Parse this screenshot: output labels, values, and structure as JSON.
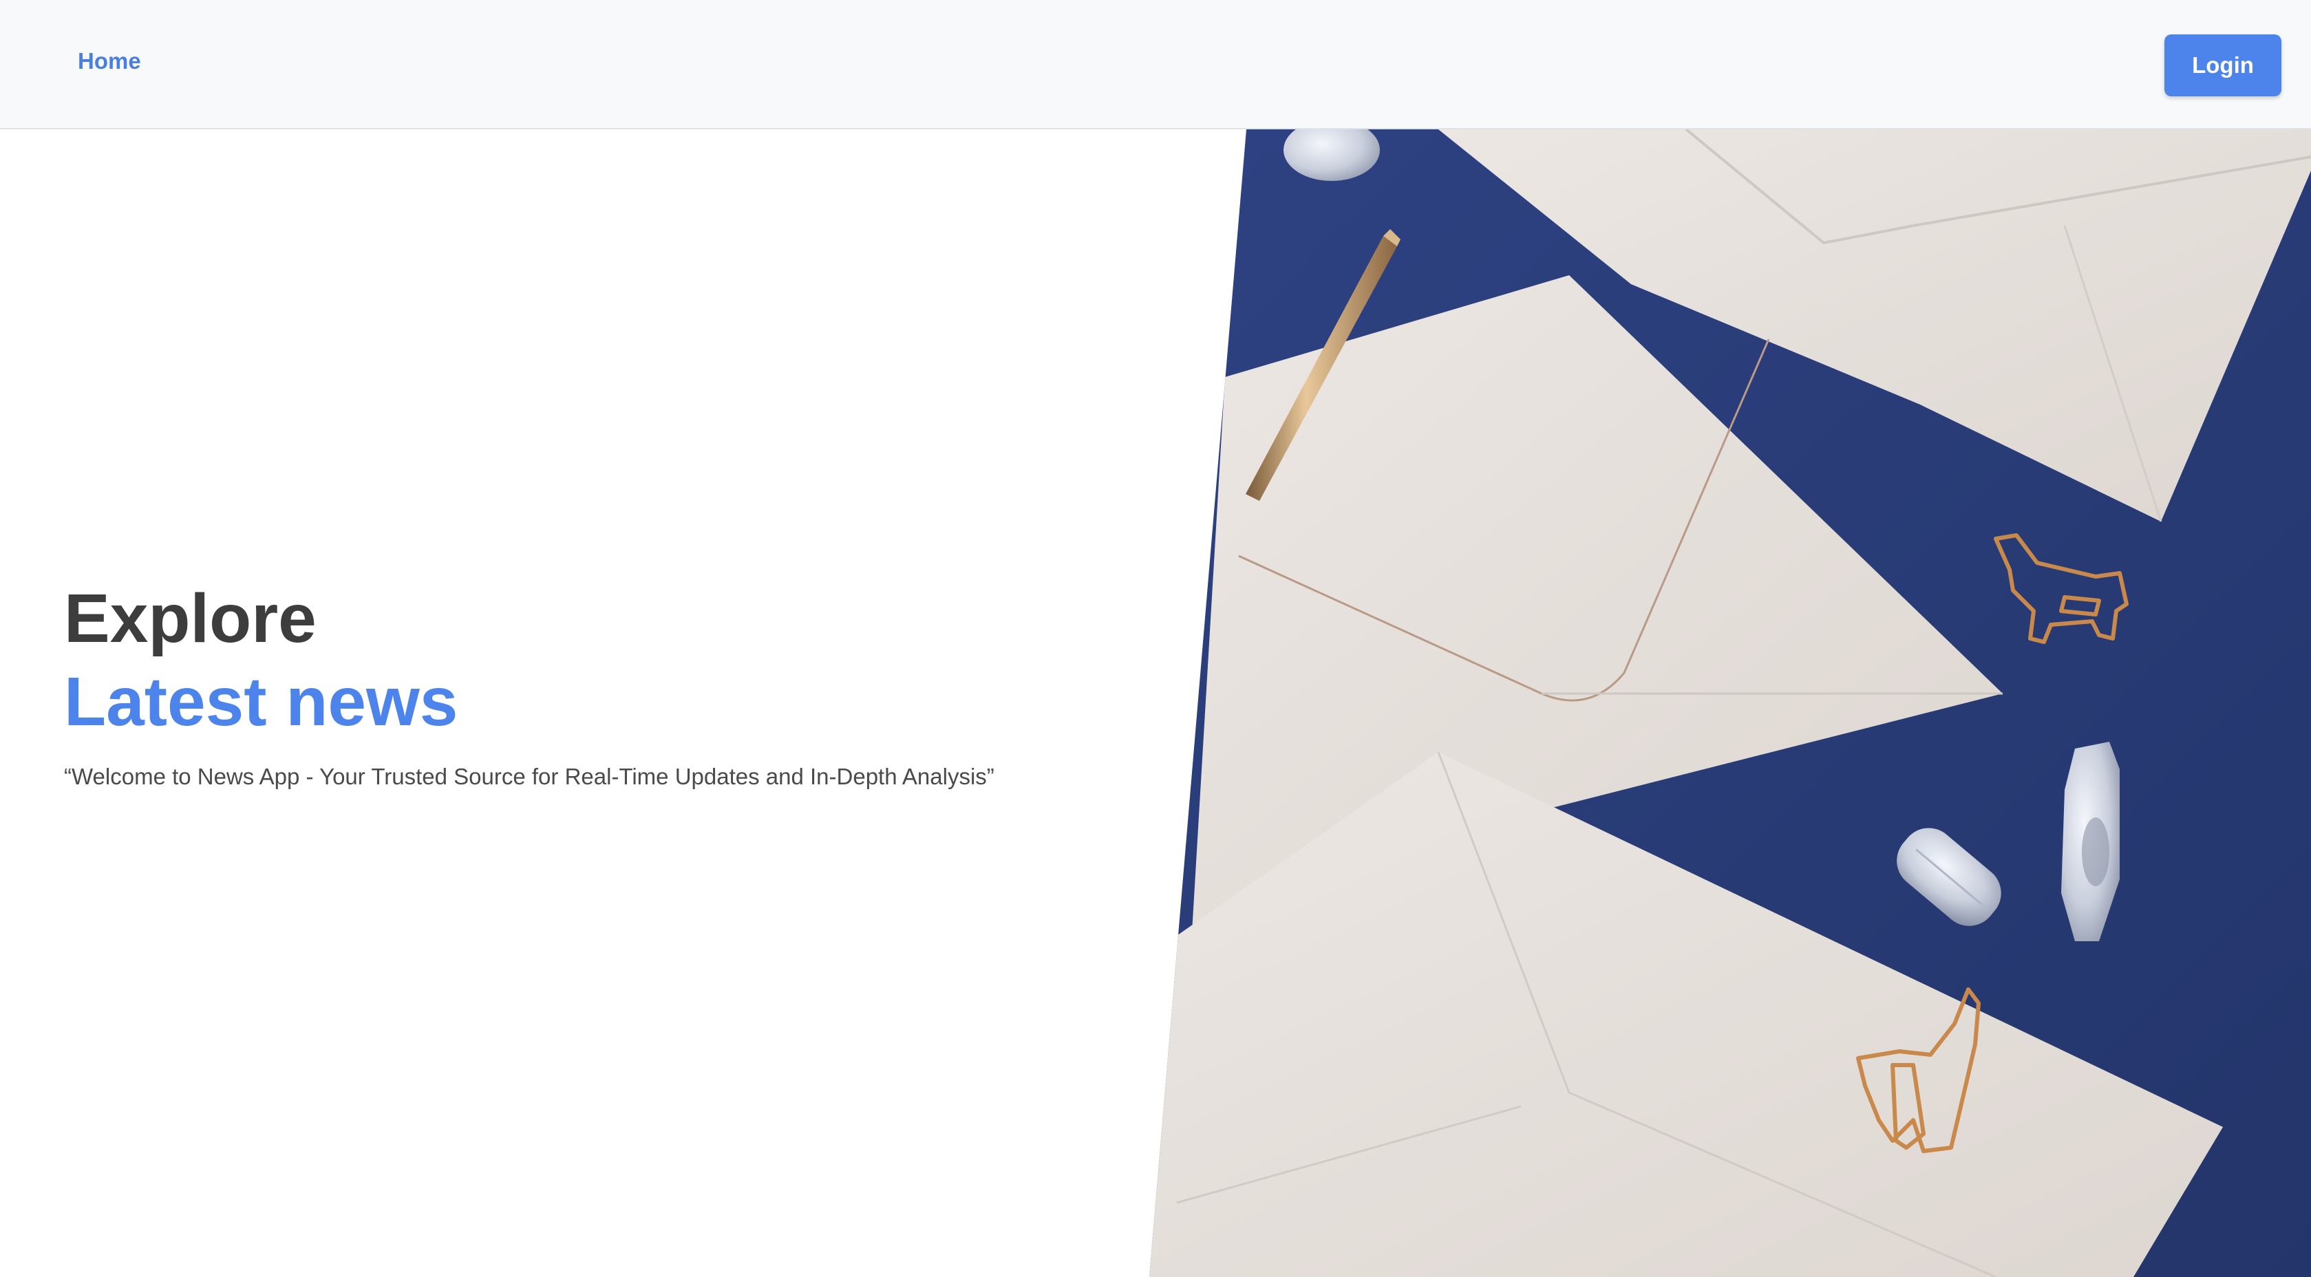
{
  "navbar": {
    "home_label": "Home",
    "login_label": "Login"
  },
  "hero": {
    "title_line1": "Explore",
    "title_line2": "Latest news",
    "subtitle": "“Welcome to News App - Your Trusted Source for Real-Time Updates and In-Depth Analysis”"
  },
  "image": {
    "subject": "Envelopes, paper clips, quartz crystals and a gold pen on navy background"
  },
  "colors": {
    "accent": "#4c84ec",
    "navbar_bg": "#f8f9fa",
    "heading_dark": "#3d3d3d",
    "image_bg": "#2b3f7a",
    "envelope": "#e6e0dc",
    "gold": "#c8894a"
  }
}
